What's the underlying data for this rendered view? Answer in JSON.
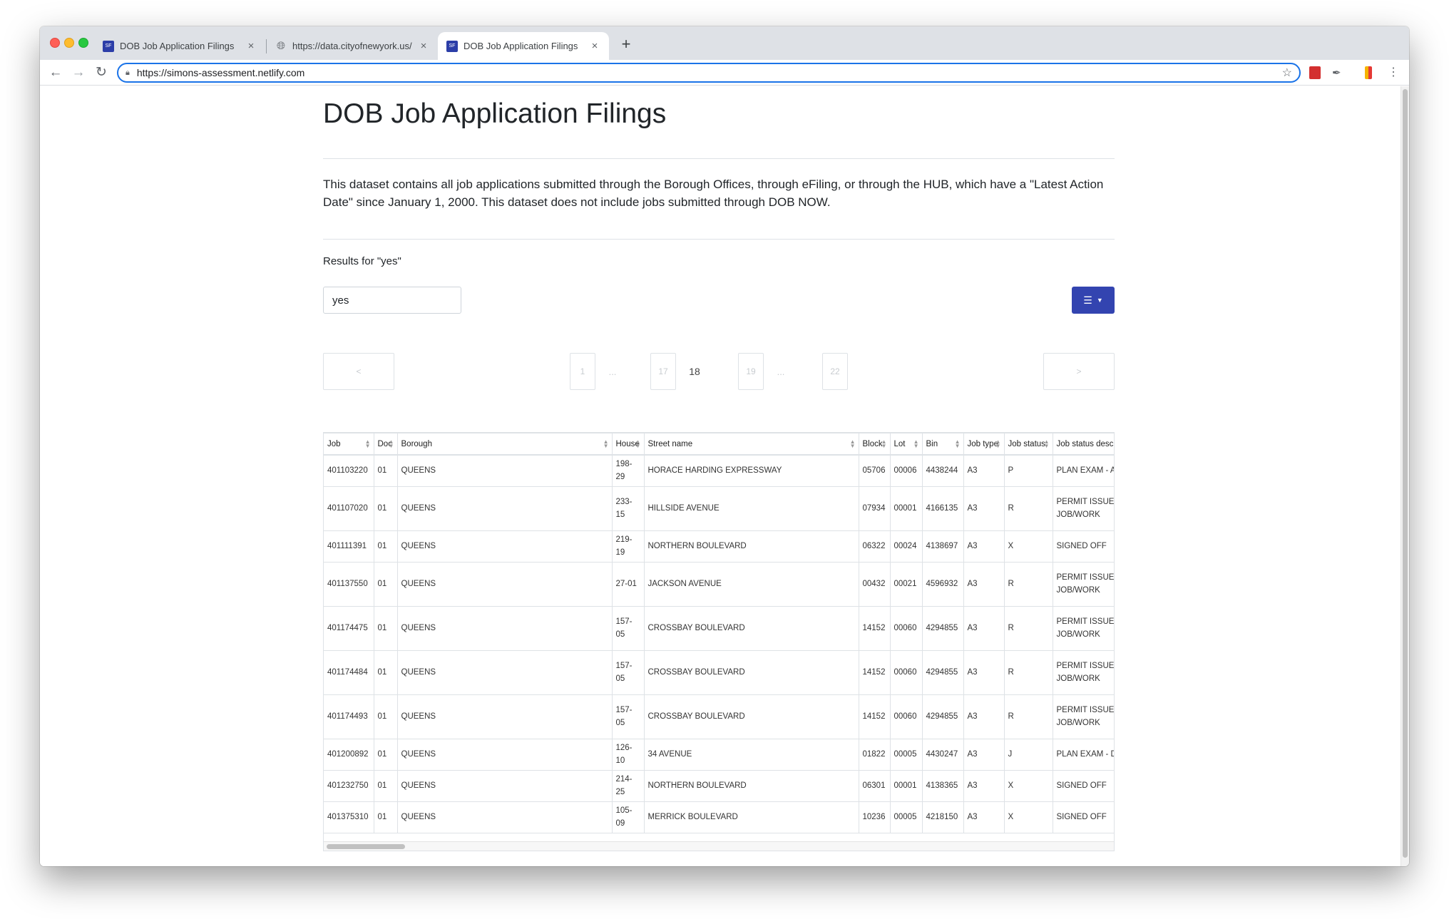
{
  "browser": {
    "tabs": [
      {
        "title": "DOB Job Application Filings",
        "favicon": "SF"
      },
      {
        "title": "https://data.cityofnewyork.us/...",
        "favicon": "globe-icon"
      },
      {
        "title": "DOB Job Application Filings",
        "favicon": "SF"
      }
    ],
    "new_tab": "+",
    "url": "https://simons-assessment.netlify.com"
  },
  "page": {
    "title": "DOB Job Application Filings",
    "description": "This dataset contains all job applications submitted through the Borough Offices, through eFiling, or through the HUB, which have a \"Latest Action Date\" since January 1, 2000. This dataset does not include jobs submitted through DOB NOW.",
    "results_label": "Results for \"yes\"",
    "search_value": "yes"
  },
  "pager": {
    "prev": "<",
    "next": ">",
    "first": "1",
    "dots": "...",
    "prev_page": "17",
    "current": "18",
    "next_page": "19",
    "last": "22"
  },
  "table": {
    "columns": [
      "Job",
      "Doc",
      "Borough",
      "House",
      "Street name",
      "Block",
      "Lot",
      "Bin",
      "Job type",
      "Job status",
      "Job status desc"
    ],
    "rows": [
      [
        "401103220",
        "01",
        "QUEENS",
        "198-29",
        "HORACE HARDING EXPRESSWAY",
        "05706",
        "00006",
        "4438244",
        "A3",
        "P",
        "PLAN EXAM - APPROVED"
      ],
      [
        "401107020",
        "01",
        "QUEENS",
        "233-15",
        "HILLSIDE AVENUE",
        "07934",
        "00001",
        "4166135",
        "A3",
        "R",
        "PERMIT ISSUED ENTIRE JOB/WORK"
      ],
      [
        "401111391",
        "01",
        "QUEENS",
        "219-19",
        "NORTHERN BOULEVARD",
        "06322",
        "00024",
        "4138697",
        "A3",
        "X",
        "SIGNED OFF"
      ],
      [
        "401137550",
        "01",
        "QUEENS",
        "27-01",
        "JACKSON AVENUE",
        "00432",
        "00021",
        "4596932",
        "A3",
        "R",
        "PERMIT ISSUED ENTIRE JOB/WORK"
      ],
      [
        "401174475",
        "01",
        "QUEENS",
        "157-05",
        "CROSSBAY BOULEVARD",
        "14152",
        "00060",
        "4294855",
        "A3",
        "R",
        "PERMIT ISSUED ENTIRE JOB/WORK"
      ],
      [
        "401174484",
        "01",
        "QUEENS",
        "157-05",
        "CROSSBAY BOULEVARD",
        "14152",
        "00060",
        "4294855",
        "A3",
        "R",
        "PERMIT ISSUED ENTIRE JOB/WORK"
      ],
      [
        "401174493",
        "01",
        "QUEENS",
        "157-05",
        "CROSSBAY BOULEVARD",
        "14152",
        "00060",
        "4294855",
        "A3",
        "R",
        "PERMIT ISSUED ENTIRE JOB/WORK"
      ],
      [
        "401200892",
        "01",
        "QUEENS",
        "126-10",
        "34 AVENUE",
        "01822",
        "00005",
        "4430247",
        "A3",
        "J",
        "PLAN EXAM - DISAPPROVED"
      ],
      [
        "401232750",
        "01",
        "QUEENS",
        "214-25",
        "NORTHERN BOULEVARD",
        "06301",
        "00001",
        "4138365",
        "A3",
        "X",
        "SIGNED OFF"
      ],
      [
        "401375310",
        "01",
        "QUEENS",
        "105-09",
        "MERRICK BOULEVARD",
        "10236",
        "00005",
        "4218150",
        "A3",
        "X",
        "SIGNED OFF"
      ]
    ]
  },
  "colors": {
    "accent": "#3344b0",
    "tabstrip": "#dee1e6",
    "omnibox_focus": "#1a73e8"
  }
}
